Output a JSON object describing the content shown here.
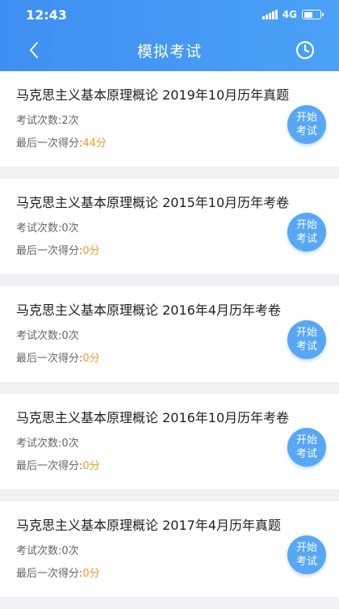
{
  "status_bar": {
    "time": "12:43",
    "network": "4G",
    "battery_level": 0.55
  },
  "nav": {
    "title": "模拟考试",
    "back_icon": "chevron-left-icon",
    "history_icon": "clock-icon"
  },
  "colors": {
    "header_start": "#3f8ff2",
    "header_end": "#4aa1f6",
    "score": "#f39a2b",
    "button": "#57a7f5"
  },
  "exams": [
    {
      "name": "马克思主义基本原理概论 2019年10月历年真题",
      "count_label": "考试次数:",
      "count": "2次",
      "score_label": "最后一次得分:",
      "score": "44分",
      "button_line1": "开始",
      "button_line2": "考试"
    },
    {
      "name": "马克思主义基本原理概论 2015年10月历年考卷",
      "count_label": "考试次数:",
      "count": "0次",
      "score_label": "最后一次得分:",
      "score": "0分",
      "button_line1": "开始",
      "button_line2": "考试"
    },
    {
      "name": "马克思主义基本原理概论 2016年4月历年考卷",
      "count_label": "考试次数:",
      "count": "0次",
      "score_label": "最后一次得分:",
      "score": "0分",
      "button_line1": "开始",
      "button_line2": "考试"
    },
    {
      "name": "马克思主义基本原理概论 2016年10月历年考卷",
      "count_label": "考试次数:",
      "count": "0次",
      "score_label": "最后一次得分:",
      "score": "0分",
      "button_line1": "开始",
      "button_line2": "考试"
    },
    {
      "name": "马克思主义基本原理概论 2017年4月历年真题",
      "count_label": "考试次数:",
      "count": "0次",
      "score_label": "最后一次得分:",
      "score": "0分",
      "button_line1": "开始",
      "button_line2": "考试"
    }
  ]
}
